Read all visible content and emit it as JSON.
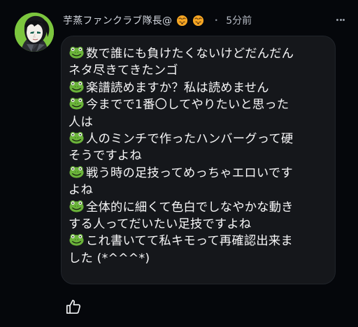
{
  "comment": {
    "author": "芋蒸ファンクラブ隊長@",
    "author_emojis": [
      "face-emoji",
      "face-emoji"
    ],
    "separator": "・",
    "time": "5分前",
    "message_lines": [
      {
        "icon": "frog-icon",
        "text": "数で誰にも負けたくないけどだんだん"
      },
      {
        "icon": "",
        "text": "ネタ尽きてきたンゴ"
      },
      {
        "icon": "frog-icon",
        "text": "楽譜読めますか？私は読めません"
      },
      {
        "icon": "frog-icon",
        "text": "今までで1番〇してやりたいと思った"
      },
      {
        "icon": "",
        "text": "人は"
      },
      {
        "icon": "frog-icon",
        "text": "人のミンチで作ったハンバーグって硬"
      },
      {
        "icon": "",
        "text": "そうですよね"
      },
      {
        "icon": "frog-icon",
        "text": "戦う時の足技ってめっちゃエロいです"
      },
      {
        "icon": "",
        "text": "よね"
      },
      {
        "icon": "frog-icon",
        "text": "全体的に細くて色白でしなやかな動き"
      },
      {
        "icon": "",
        "text": "する人ってだいたい足技ですよね"
      },
      {
        "icon": "frog-icon",
        "text": "これ書いてて私キモって再確認出来ま"
      },
      {
        "icon": "",
        "text": "した (*^^^*)"
      }
    ]
  },
  "icons": {
    "avatar": "avatar",
    "menu": "more-options-icon",
    "like": "thumbs-up-icon"
  },
  "colors": {
    "background": "#05070b",
    "bubble": "#15171b",
    "text": "#f7f7f8",
    "meta_text": "#b7bcc5",
    "frog_green": "#6bb33a",
    "face_orange": "#f6a623"
  }
}
